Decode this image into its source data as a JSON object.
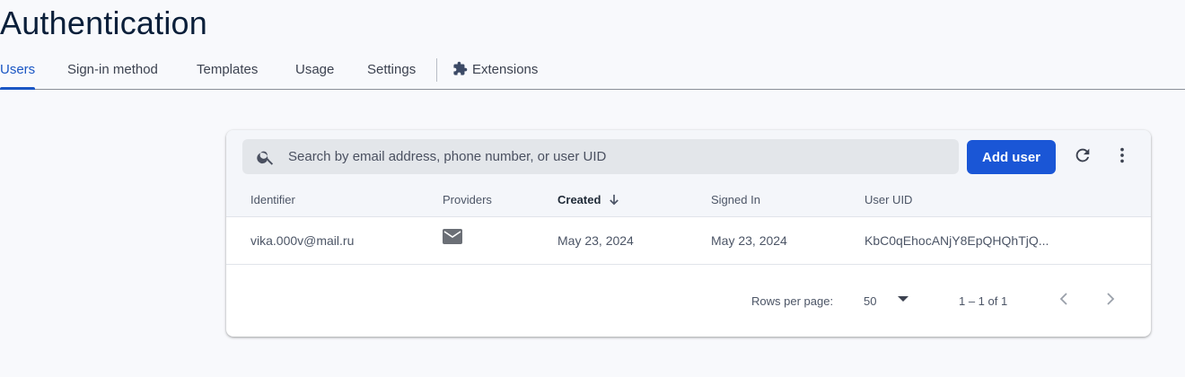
{
  "page": {
    "title": "Authentication"
  },
  "tabs": [
    {
      "label": "Users",
      "active": true
    },
    {
      "label": "Sign-in method",
      "active": false
    },
    {
      "label": "Templates",
      "active": false
    },
    {
      "label": "Usage",
      "active": false
    },
    {
      "label": "Settings",
      "active": false
    },
    {
      "label": "Extensions",
      "active": false,
      "icon": "puzzle-icon"
    }
  ],
  "toolbar": {
    "search_placeholder": "Search by email address, phone number, or user UID",
    "search_icon": "search-icon",
    "add_user_label": "Add user",
    "refresh_icon": "refresh-icon",
    "more_icon": "more-vert-icon"
  },
  "table": {
    "columns": [
      "Identifier",
      "Providers",
      "Created",
      "Signed In",
      "User UID"
    ],
    "sorted_column": "Created",
    "sort_direction": "descending",
    "rows": [
      {
        "identifier": "vika.000v@mail.ru",
        "provider_icon": "email-icon",
        "created": "May 23, 2024",
        "signed_in": "May 23, 2024",
        "user_uid": "KbC0qEhocANjY8EpQHQhTjQ..."
      }
    ]
  },
  "pagination": {
    "rows_per_page_label": "Rows per page:",
    "rows_per_page_value": "50",
    "range_text": "1 – 1 of 1",
    "prev_icon": "chevron-left-icon",
    "next_icon": "chevron-right-icon"
  },
  "colors": {
    "accent": "#1a56c4",
    "primary_button": "#1a56d6",
    "background": "#f8f9fc"
  }
}
